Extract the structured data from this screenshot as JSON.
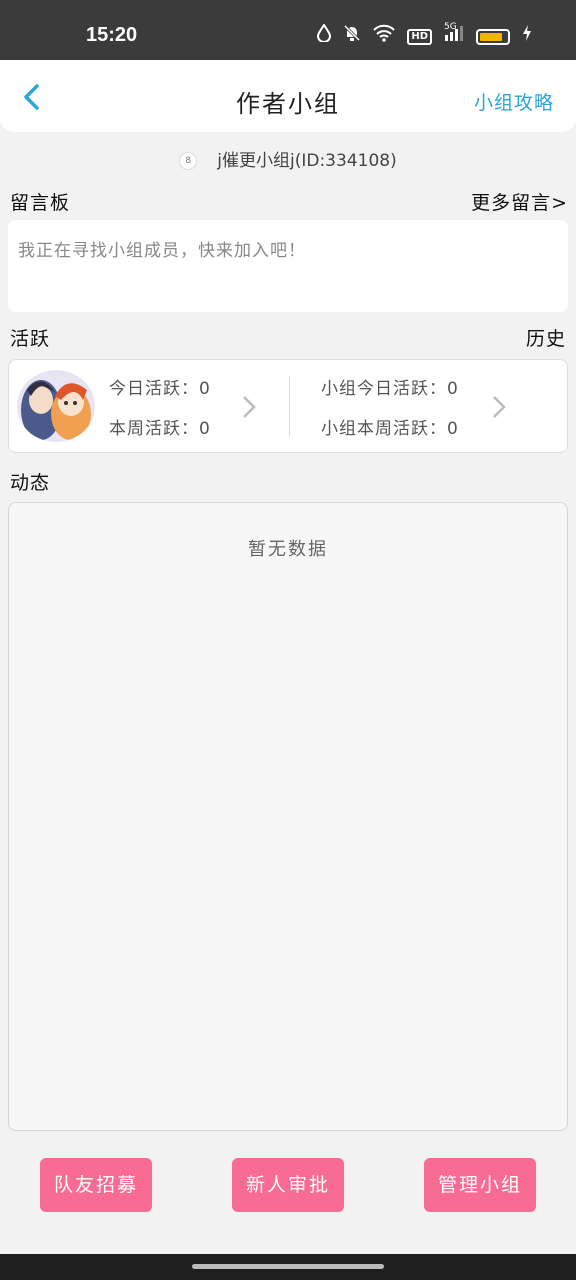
{
  "status_bar": {
    "time": "15:20",
    "hd": "HD",
    "network": "5G",
    "icons": [
      "water-drop-icon",
      "bell-off-icon",
      "wifi-icon",
      "hd-icon",
      "signal-icon",
      "battery-icon",
      "charging-icon"
    ]
  },
  "header": {
    "title": "作者小组",
    "guide_link": "小组攻略",
    "back_icon": "chevron-left-icon"
  },
  "group": {
    "id_text": "j催更小组j(ID:334108)"
  },
  "message_board": {
    "label": "留言板",
    "more_link": "更多留言>",
    "placeholder": "我正在寻找小组成员，快来加入吧！"
  },
  "activity": {
    "label": "活跃",
    "history_link": "历史",
    "today_active": "今日活跃：0",
    "week_active": "本周活跃：0",
    "group_today_active": "小组今日活跃：0",
    "group_week_active": "小组本周活跃：0"
  },
  "feed": {
    "label": "动态",
    "empty_text": "暂无数据"
  },
  "actions": {
    "recruit": "队友招募",
    "approve": "新人审批",
    "manage": "管理小组"
  },
  "colors": {
    "accent_blue": "#2aa6d8",
    "button_pink": "#f86b93",
    "status_bar": "#3b3b3b"
  }
}
